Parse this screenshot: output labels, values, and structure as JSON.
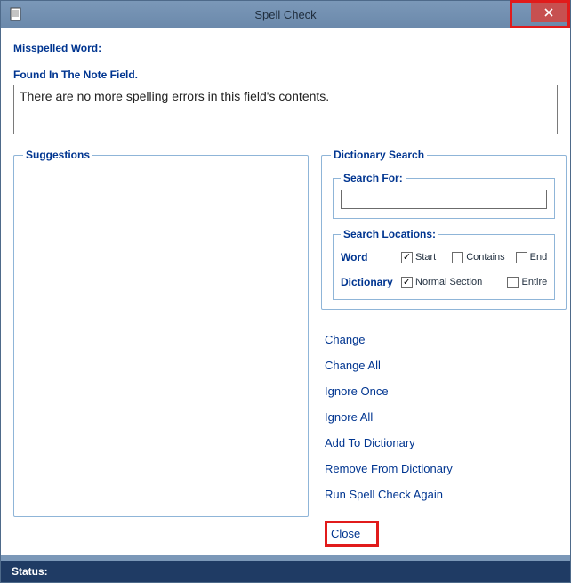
{
  "window": {
    "title": "Spell Check"
  },
  "labels": {
    "misspelled_word": "Misspelled Word:",
    "found_in": "Found In The Note Field.",
    "field_message": "There are no more spelling errors in this field's contents."
  },
  "suggestions": {
    "legend": "Suggestions"
  },
  "dictionary": {
    "legend": "Dictionary Search",
    "search_for_legend": "Search For:",
    "search_value": "",
    "locations_legend": "Search Locations:",
    "row_word_label": "Word",
    "row_dict_label": "Dictionary",
    "checks": {
      "start": {
        "label": "Start",
        "checked": true
      },
      "contains": {
        "label": "Contains",
        "checked": false
      },
      "end": {
        "label": "End",
        "checked": false
      },
      "normal_section": {
        "label": "Normal Section",
        "checked": true
      },
      "entire": {
        "label": "Entire",
        "checked": false
      }
    }
  },
  "actions": {
    "change": "Change",
    "change_all": "Change All",
    "ignore_once": "Ignore Once",
    "ignore_all": "Ignore All",
    "add_to_dict": "Add To Dictionary",
    "remove_from_dict": "Remove From Dictionary",
    "run_again": "Run Spell Check Again",
    "close": "Close"
  },
  "status": {
    "label": "Status:",
    "value": ""
  }
}
